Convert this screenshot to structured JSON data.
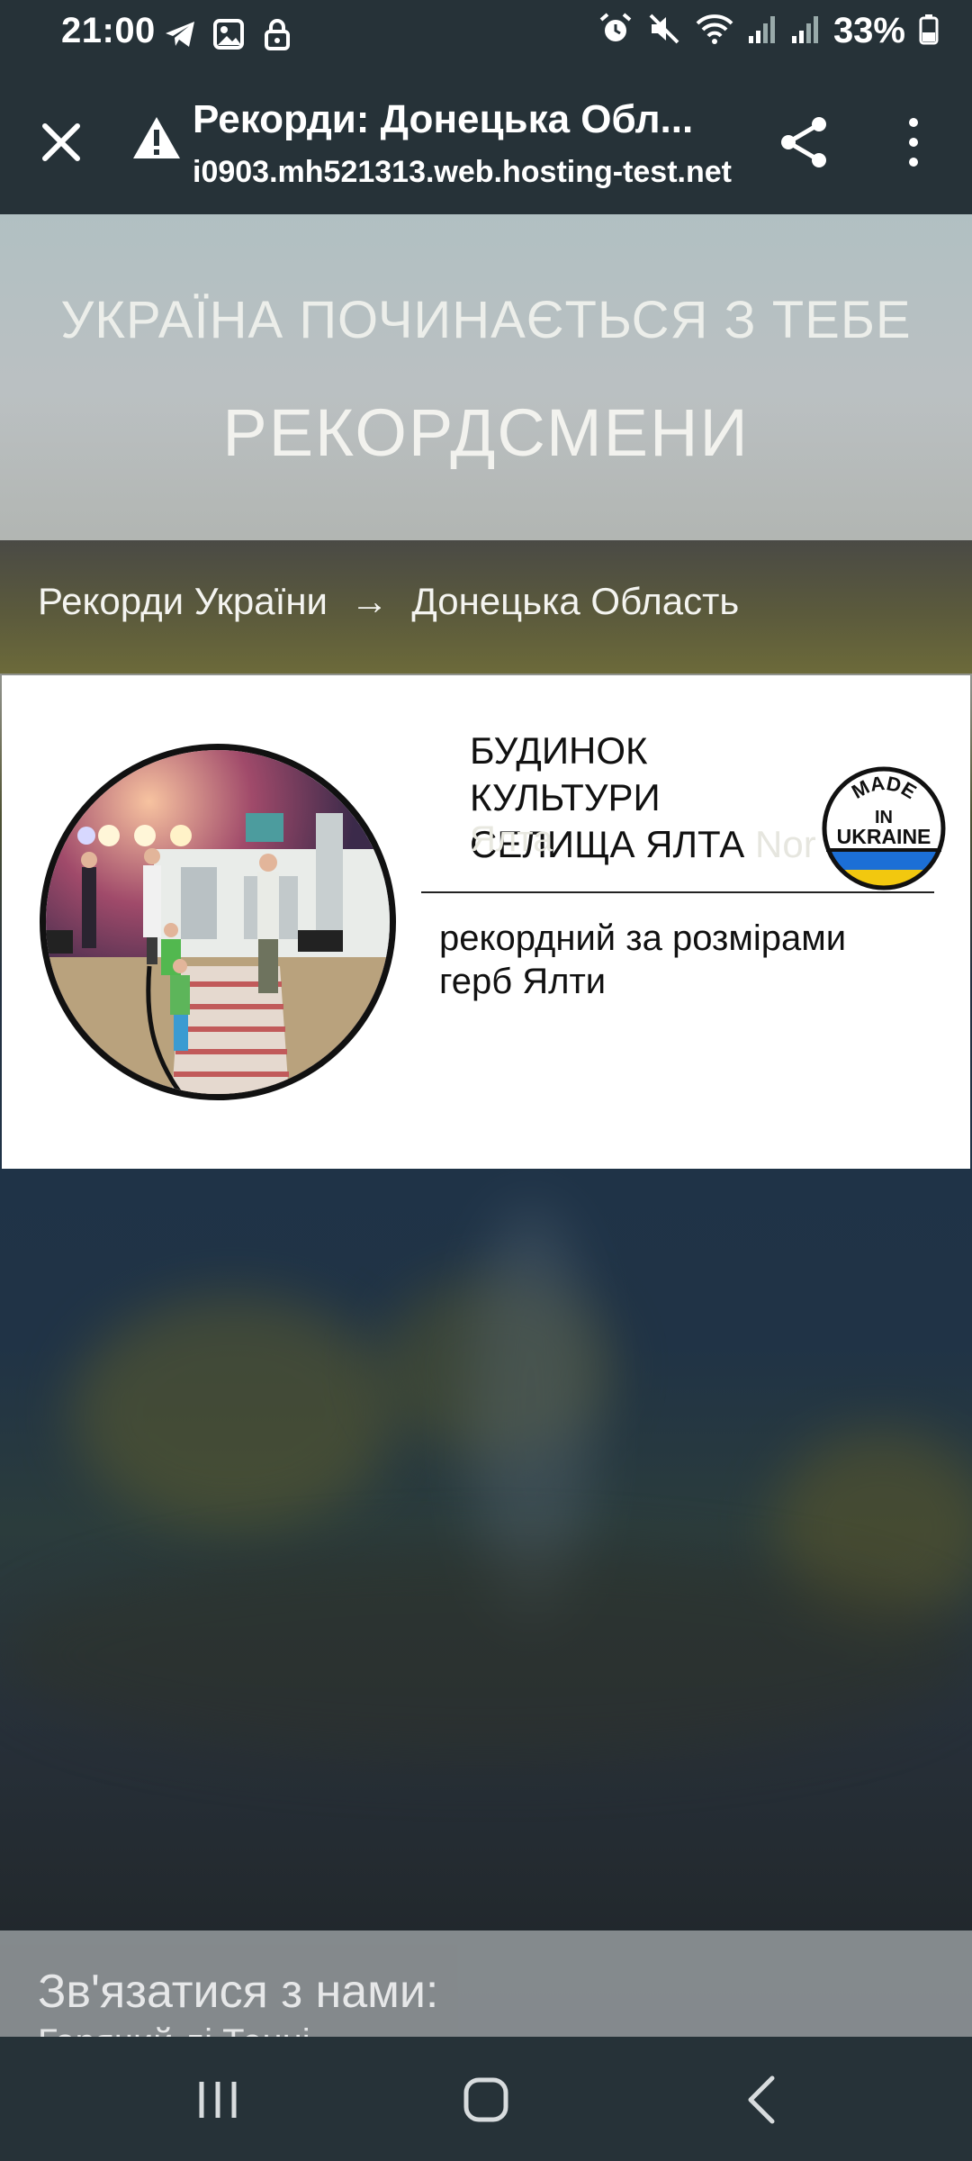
{
  "status_bar": {
    "time": "21:00",
    "left_icons": [
      "telegram-icon",
      "gallery-icon",
      "lock-icon"
    ],
    "right_icons": [
      "alarm-icon",
      "mute-icon",
      "wifi-icon",
      "signal-icon",
      "signal-icon",
      "battery-icon"
    ],
    "battery_percent": "33%"
  },
  "toolbar": {
    "title": "Рекорди: Донецька Обл...",
    "url": "i0903.mh521313.web.hosting-test.net",
    "close_icon": "close-icon",
    "warning_icon": "warning-icon",
    "share_icon": "share-icon",
    "menu_icon": "more-vertical-icon"
  },
  "hero": {
    "slogan": "УКРАЇНА ПОЧИНАЄТЬСЯ З ТЕБЕ",
    "title": "РЕКОРДСМЕНИ"
  },
  "breadcrumb": {
    "root": "Рекорди України",
    "separator": "→",
    "current": "Донецька Область"
  },
  "record": {
    "title_line1": "БУДИНОК КУЛЬТУРИ",
    "title_line2": "СЕЛИЩА ЯЛТА",
    "title_ghost": "Nor",
    "subtitle_ghost": "Ялта",
    "description": "рекордний за розмірами герб Ялти",
    "badge": {
      "line1": "MADE",
      "line2": "IN",
      "line3": "UKRAINE",
      "colors": [
        "#1c6fd6",
        "#f2c80f"
      ]
    }
  },
  "footer": {
    "contact_heading": "Зв'язатися з нами:",
    "contact_partial": "Гарячий лі Тенні..."
  },
  "nav_bar": {
    "recents_icon": "recents-icon",
    "home_icon": "home-icon",
    "back_icon": "back-icon"
  }
}
